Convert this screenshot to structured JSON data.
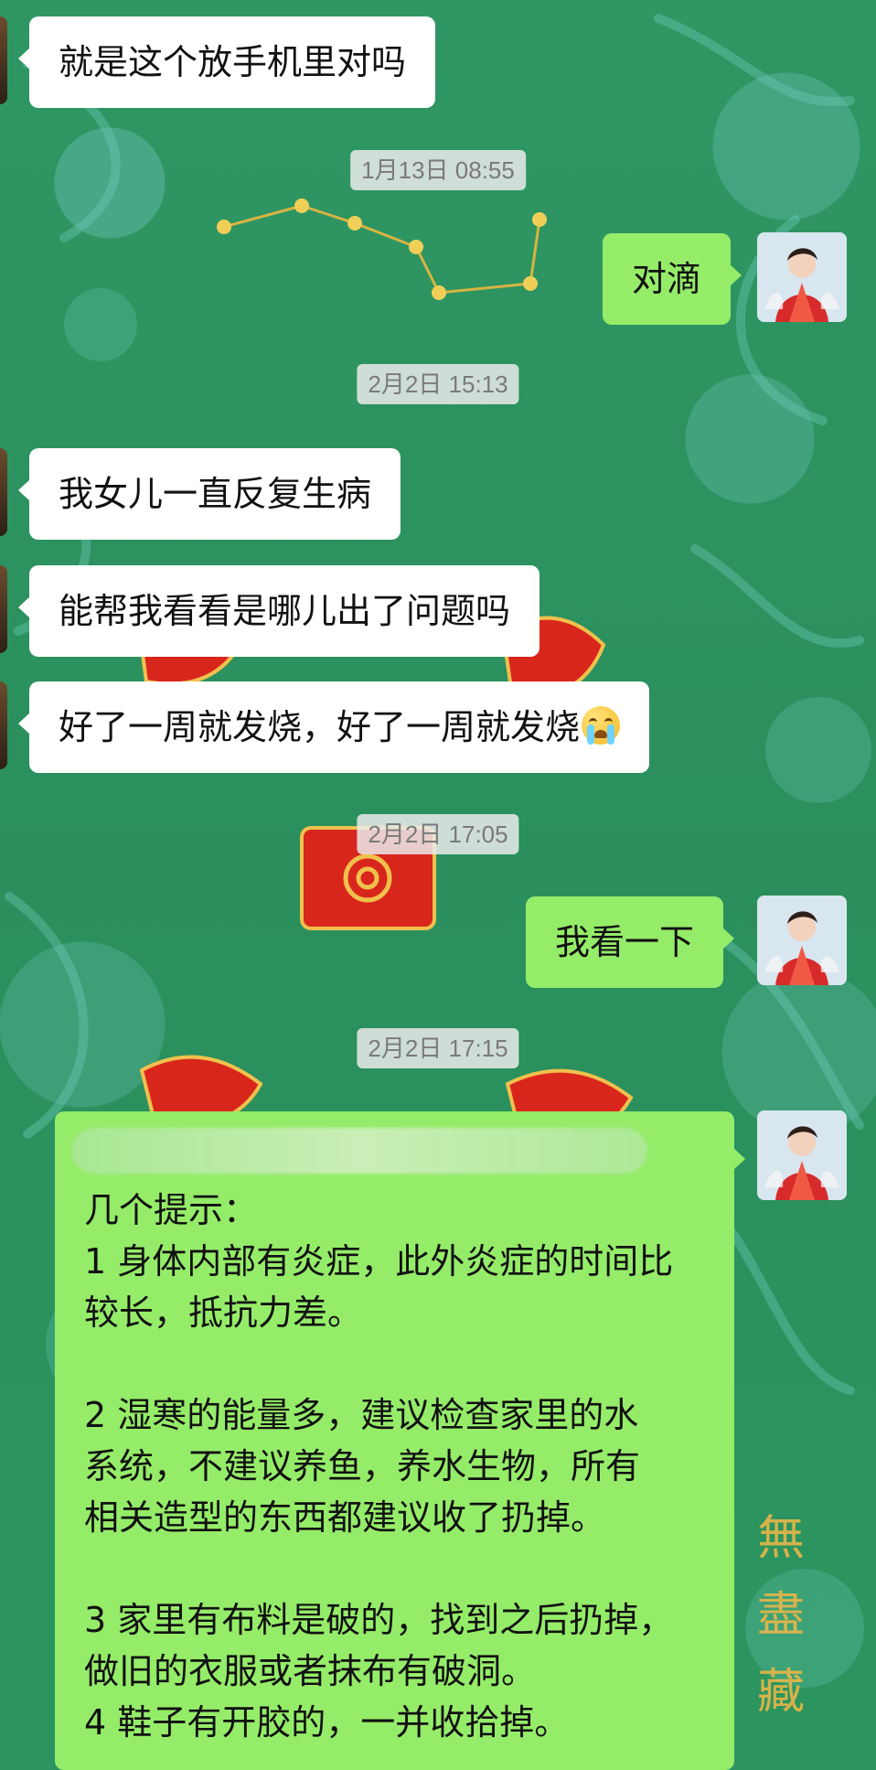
{
  "messages": [
    {
      "type": "text",
      "side": "left",
      "text": "就是这个放手机里对吗"
    },
    {
      "type": "time",
      "text": "1月13日 08:55"
    },
    {
      "type": "text",
      "side": "right",
      "text": "对滴"
    },
    {
      "type": "time",
      "text": "2月2日 15:13"
    },
    {
      "type": "text",
      "side": "left",
      "text": "我女儿一直反复生病"
    },
    {
      "type": "text",
      "side": "left",
      "text": "能帮我看看是哪儿出了问题吗"
    },
    {
      "type": "text",
      "side": "left",
      "text": "好了一周就发烧，好了一周就发烧",
      "emoji": "crying-face-emoji"
    },
    {
      "type": "time",
      "text": "2月2日 17:05"
    },
    {
      "type": "text",
      "side": "right",
      "text": "我看一下"
    },
    {
      "type": "time",
      "text": "2月2日 17:15"
    },
    {
      "type": "text",
      "side": "right",
      "text": "几个提示：\n1 身体内部有炎症，此外炎症的时间比较长，抵抗力差。\n\n2 湿寒的能量多，建议检查家里的水系统，不建议养鱼，养水生物，所有相关造型的东西都建议收了扔掉。\n\n3 家里有布料是破的，找到之后扔掉，做旧的衣服或者抹布有破洞。\n4 鞋子有开胶的，一并收拾掉。"
    }
  ],
  "long_message_display": "几个提示：\n1 身体内部有炎症，此外炎症的时间比\n较长，抵抗力差。\n\n2 湿寒的能量多，建议检查家里的水\n系统，不建议养鱼，养水生物，所有\n相关造型的东西都建议收了扔掉。\n\n3 家里有布料是破的，找到之后扔掉，\n做旧的衣服或者抹布有破洞。\n4 鞋子有开胶的，一并收拾掉。",
  "watermark_text": "無盡藏",
  "colors": {
    "background": "#2d9461",
    "incoming_bubble": "#ffffff",
    "outgoing_bubble": "#95ec69",
    "timestamp_bg": "#ebebeb",
    "timestamp_text": "#7a7a7a",
    "accent_gold": "#e9b548",
    "accent_red": "#d9261c"
  },
  "icons": {
    "incoming_avatar": "avatar-partial",
    "outgoing_avatar": "avatar-woman-red-dress"
  }
}
